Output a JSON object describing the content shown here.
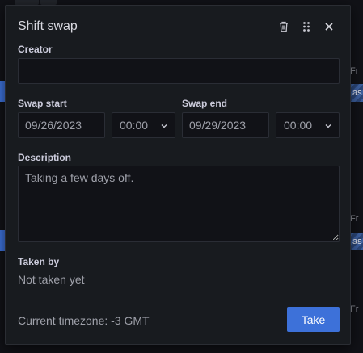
{
  "dialog": {
    "title": "Shift swap",
    "creator_label": "Creator",
    "creator_value": "",
    "swap_start_label": "Swap start",
    "swap_start_date": "09/26/2023",
    "swap_start_time": "00:00",
    "swap_end_label": "Swap end",
    "swap_end_date": "09/29/2023",
    "swap_end_time": "00:00",
    "description_label": "Description",
    "description_value": "Taking a few days off.",
    "taken_by_label": "Taken by",
    "taken_by_value": "Not taken yet",
    "timezone_text": "Current timezone: -3 GMT",
    "take_button": "Take"
  },
  "background": {
    "right_labels": [
      "Fr",
      "as",
      "Fr",
      "as",
      "Fr"
    ]
  },
  "colors": {
    "accent": "#3d71d9",
    "dialog_bg": "#181b1f",
    "input_bg": "#111217"
  }
}
